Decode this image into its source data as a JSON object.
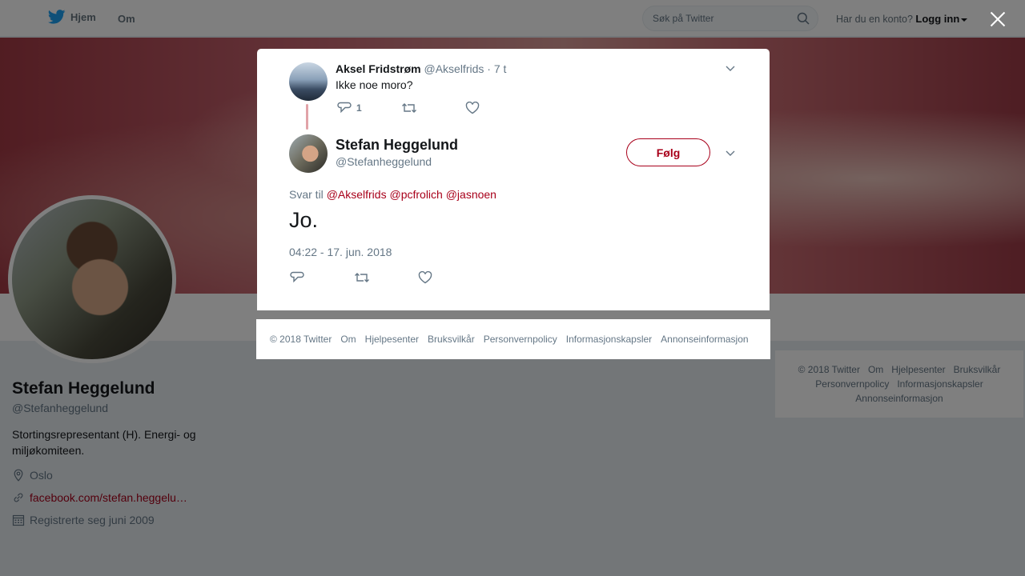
{
  "nav": {
    "home_label": "Hjem",
    "about_label": "Om",
    "search_placeholder": "Søk på Twitter",
    "account_prompt": "Har du en konto?",
    "login_label": "Logg inn"
  },
  "profile": {
    "name": "Stefan Heggelund",
    "handle": "@Stefanheggelund",
    "bio": "Stortingsrepresentant (H). Energi- og miljøkomiteen.",
    "location": "Oslo",
    "website": "facebook.com/stefan.heggelu…",
    "joined": "Registrerte seg juni 2009"
  },
  "footer_right": {
    "items": [
      "© 2018 Twitter",
      "Om",
      "Hjelpesenter",
      "Bruksvilkår",
      "Personvernpolicy",
      "Informasjonskapsler",
      "Annonseinformasjon"
    ]
  },
  "modal": {
    "parent": {
      "name": "Aksel Fridstrøm",
      "handle": "@Akselfrids",
      "time": "· 7 t",
      "text": "Ikke noe moro?",
      "reply_count": "1"
    },
    "tweet": {
      "name": "Stefan Heggelund",
      "handle": "@Stefanheggelund",
      "follow_label": "Følg",
      "reply_prefix": "Svar til",
      "mentions": [
        "@Akselfrids",
        "@pcfrolich",
        "@jasnoen"
      ],
      "text": "Jo.",
      "timestamp": "04:22 - 17. jun. 2018"
    }
  },
  "footer_modal": {
    "items": [
      "© 2018 Twitter",
      "Om",
      "Hjelpesenter",
      "Bruksvilkår",
      "Personvernpolicy",
      "Informasjonskapsler",
      "Annonseinformasjon"
    ]
  },
  "colors": {
    "accent": "#a8001a",
    "twitter_blue": "#1da1f2",
    "muted": "#657786"
  }
}
